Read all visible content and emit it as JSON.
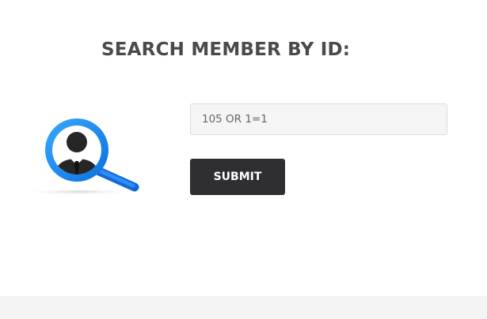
{
  "header": {
    "title": "SEARCH MEMBER BY ID:"
  },
  "logo": {
    "icon": "member-search-icon",
    "ring_color": "#1e8ff0",
    "handle_color": "#1877e6",
    "person_color": "#222222"
  },
  "search": {
    "value": "105 OR 1=1",
    "placeholder": ""
  },
  "form": {
    "submit_label": "SUBMIT"
  },
  "theme": {
    "button_bg": "#2f2f33",
    "input_bg": "#f5f5f5",
    "title_color": "#4a4a4a"
  }
}
